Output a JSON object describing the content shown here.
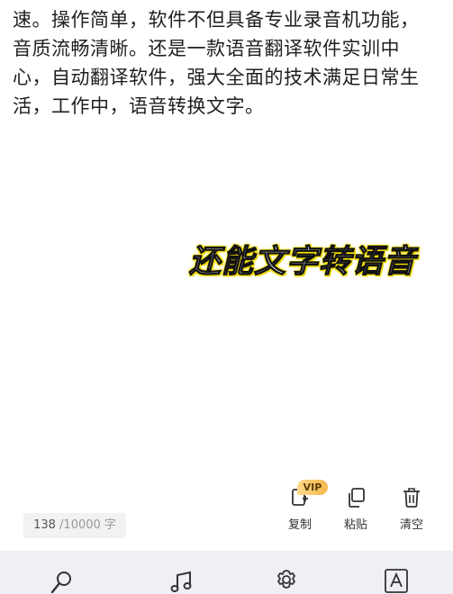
{
  "editor": {
    "lines": [
      "速。操作简单，软件不但具备专业录音机功能，",
      "音质流畅清晰。还是一款语音翻译软件实训中",
      "心，自动翻译软件，强大全面的技术满足日常生",
      "活，工作中，语音转换文字。"
    ]
  },
  "caption": {
    "text": "还能文字转语音"
  },
  "counter": {
    "current": "138",
    "max": "/10000 字"
  },
  "actions": {
    "copy": {
      "label": "复制",
      "badge": "VIP",
      "icon": "copy-icon"
    },
    "paste": {
      "label": "粘贴",
      "icon": "paste-icon"
    },
    "clear": {
      "label": "清空",
      "icon": "trash-icon"
    }
  },
  "bottom_tabs": [
    {
      "icon": "microphone-icon"
    },
    {
      "icon": "music-note-icon"
    },
    {
      "icon": "settings-gear-icon"
    },
    {
      "icon": "text-box-icon"
    }
  ],
  "colors": {
    "caption_glow": "#f5e100",
    "vip_badge": "#f5b94e",
    "bottom_bar": "#eef0f6"
  }
}
